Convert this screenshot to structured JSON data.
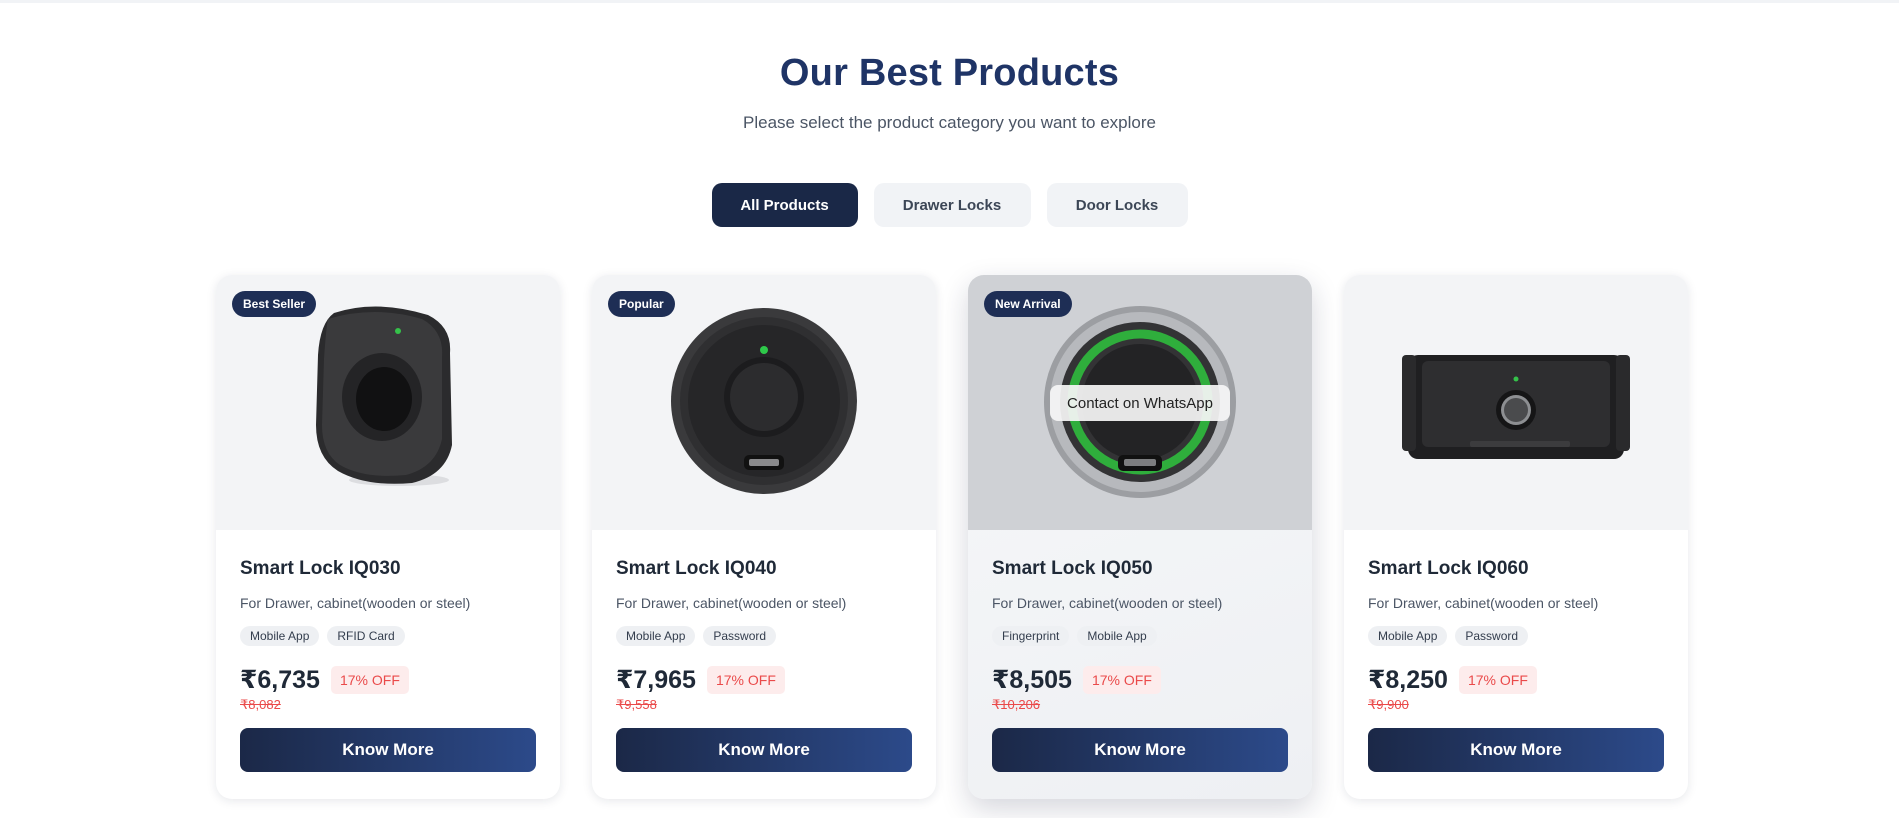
{
  "section": {
    "title": "Our Best Products",
    "subtitle": "Please select the product category you want to explore"
  },
  "tabs": [
    {
      "label": "All Products",
      "active": true
    },
    {
      "label": "Drawer Locks",
      "active": false
    },
    {
      "label": "Door Locks",
      "active": false
    }
  ],
  "products": [
    {
      "badge": "Best Seller",
      "name": "Smart Lock IQ030",
      "description": "For Drawer, cabinet(wooden or steel)",
      "features": [
        "Mobile App",
        "RFID Card"
      ],
      "price": "₹6,735",
      "discount": "17% OFF",
      "original_price": "₹8,082",
      "cta": "Know More"
    },
    {
      "badge": "Popular",
      "name": "Smart Lock IQ040",
      "description": "For Drawer, cabinet(wooden or steel)",
      "features": [
        "Mobile App",
        "Password"
      ],
      "price": "₹7,965",
      "discount": "17% OFF",
      "original_price": "₹9,558",
      "cta": "Know More"
    },
    {
      "badge": "New Arrival",
      "name": "Smart Lock IQ050",
      "description": "For Drawer, cabinet(wooden or steel)",
      "features": [
        "Fingerprint",
        "Mobile App"
      ],
      "price": "₹8,505",
      "discount": "17% OFF",
      "original_price": "₹10,206",
      "cta": "Know More",
      "overlay_label": "Contact on WhatsApp"
    },
    {
      "badge": "",
      "name": "Smart Lock IQ060",
      "description": "For Drawer, cabinet(wooden or steel)",
      "features": [
        "Mobile App",
        "Password"
      ],
      "price": "₹8,250",
      "discount": "17% OFF",
      "original_price": "₹9,900",
      "cta": "Know More"
    }
  ],
  "colors": {
    "heading": "#1f3466",
    "active_tab": "#1a2847",
    "button_gradient_start": "#1b2847",
    "button_gradient_end": "#2c4a8a",
    "discount": "#ea4a4a"
  }
}
